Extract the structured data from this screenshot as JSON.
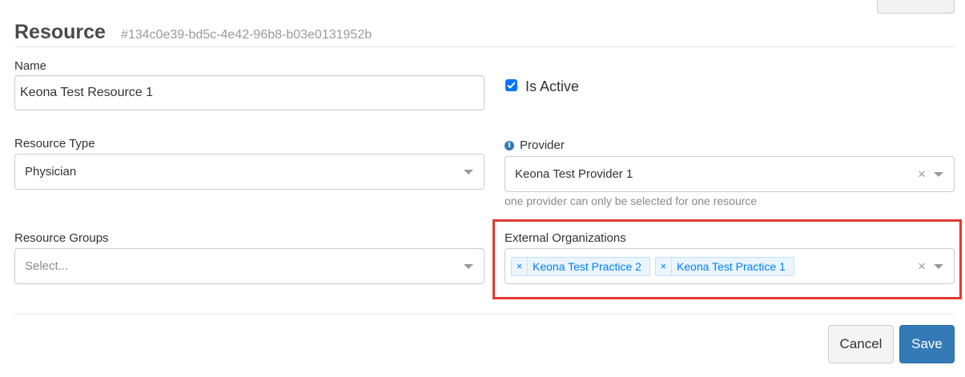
{
  "header": {
    "title": "Resource",
    "resource_id": "#134c0e39-bd5c-4e42-96b8-b03e0131952b"
  },
  "form": {
    "name": {
      "label": "Name",
      "value": "Keona Test Resource 1"
    },
    "is_active": {
      "label": "Is Active",
      "checked": true
    },
    "resource_type": {
      "label": "Resource Type",
      "value": "Physician"
    },
    "provider": {
      "label": "Provider",
      "value": "Keona Test Provider 1",
      "help": "one provider can only be selected for one resource",
      "clear": "×"
    },
    "resource_groups": {
      "label": "Resource Groups",
      "placeholder": "Select..."
    },
    "external_organizations": {
      "label": "External Organizations",
      "tags": [
        {
          "remove": "×",
          "label": "Keona Test Practice 2"
        },
        {
          "remove": "×",
          "label": "Keona Test Practice 1"
        }
      ],
      "clear": "×"
    }
  },
  "footer": {
    "cancel_label": "Cancel",
    "save_label": "Save"
  },
  "colors": {
    "accent": "#337ab7",
    "tag_text": "#007eff",
    "tag_bg": "#ebf5ff",
    "highlight": "#e03a30",
    "checkbox": "#0075ff"
  },
  "icons": {
    "info": "info-icon",
    "caret": "chevron-down-icon",
    "check": "check-icon"
  }
}
